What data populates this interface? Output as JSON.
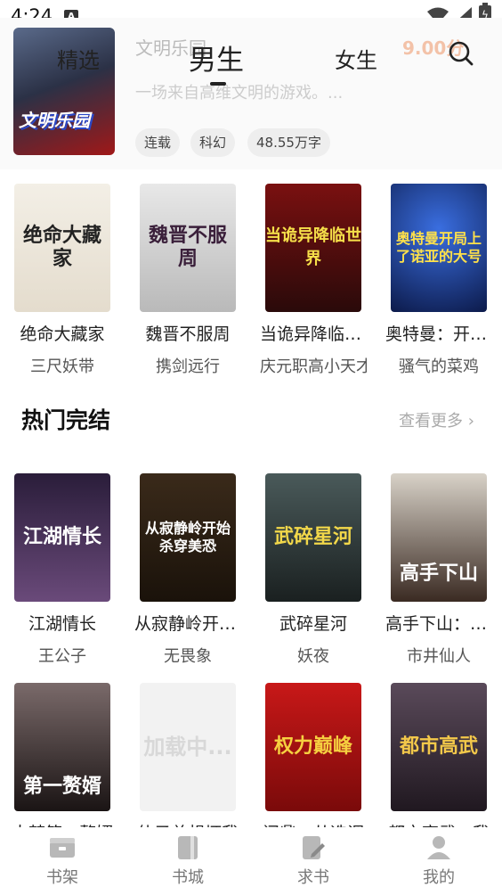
{
  "status": {
    "time": "4:24",
    "a_icon": "A"
  },
  "featured": {
    "title": "文明乐园",
    "score": "9.00分",
    "description": "一场来自高维文明的游戏。...",
    "cover_text": "文明乐园",
    "tags": [
      "连载",
      "科幻",
      "48.55万字"
    ]
  },
  "tabs": {
    "items": [
      "精选",
      "男生",
      "女生"
    ],
    "active": "男生"
  },
  "row1": [
    {
      "title": "绝命大藏家",
      "author": "三尺妖带",
      "cover_text": "绝命大藏家"
    },
    {
      "title": "魏晋不服周",
      "author": "携剑远行",
      "cover_text": "魏晋不服周"
    },
    {
      "title": "当诡异降临世...",
      "author": "庆元职高小天才",
      "cover_text": "当诡异降临世界"
    },
    {
      "title": "奥特曼：开局...",
      "author": "骚气的菜鸡",
      "cover_text": "奥特曼开局上了诺亚的大号"
    }
  ],
  "hot_section": {
    "title": "热门完结",
    "more": "查看更多"
  },
  "row2": [
    {
      "title": "江湖情长",
      "author": "王公子",
      "cover_text": "江湖情长"
    },
    {
      "title": "从寂静岭开始...",
      "author": "无畏象",
      "cover_text": "从寂静岭开始杀穿美恐"
    },
    {
      "title": "武碎星河",
      "author": "妖夜",
      "cover_text": "武碎星河"
    },
    {
      "title": "高手下山：我...",
      "author": "市井仙人",
      "cover_text": "高手下山"
    }
  ],
  "row3": [
    {
      "title": "大梦第一赘婿",
      "cover_text": "第一赘婿"
    },
    {
      "title": "仙子总想坏我",
      "cover_text": "加载中..."
    },
    {
      "title": "问鼎：从选调",
      "cover_text": "权力巅峰"
    },
    {
      "title": "都市高武：我",
      "cover_text": "都市高武"
    }
  ],
  "bottom_nav": [
    "书架",
    "书城",
    "求书",
    "我的"
  ]
}
